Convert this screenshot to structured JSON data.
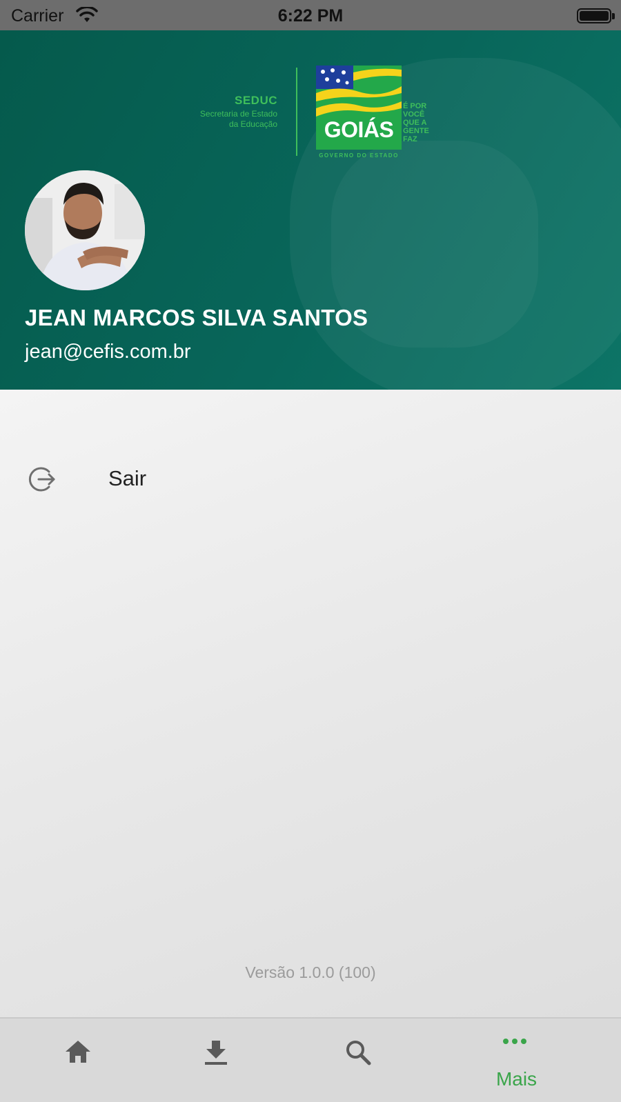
{
  "status_bar": {
    "carrier": "Carrier",
    "time": "6:22 PM"
  },
  "header": {
    "logo": {
      "seduc_title": "SEDUC",
      "seduc_line1": "Secretaria de Estado",
      "seduc_line2": "da Educação",
      "goias_word": "GOIÁS",
      "goias_gov": "GOVERNO DO ESTADO",
      "slogan": [
        "É POR",
        "VOCÊ",
        "QUE A",
        "GENTE",
        "FAZ"
      ]
    },
    "user": {
      "name": "JEAN MARCOS SILVA SANTOS",
      "email": "jean@cefis.com.br"
    }
  },
  "menu": {
    "items": [
      {
        "label": "Sair",
        "icon": "logout-icon"
      }
    ]
  },
  "version": "Versão 1.0.0 (100)",
  "tabbar": {
    "tabs": [
      {
        "icon": "home-icon",
        "label": ""
      },
      {
        "icon": "download-icon",
        "label": ""
      },
      {
        "icon": "search-icon",
        "label": ""
      },
      {
        "icon": "more-dots-icon",
        "label": "Mais"
      }
    ],
    "active_color": "#3aa54a",
    "inactive_color": "#5a5a5a"
  },
  "colors": {
    "header_bg": "#08665a",
    "brand_green": "#3fbf5b"
  }
}
